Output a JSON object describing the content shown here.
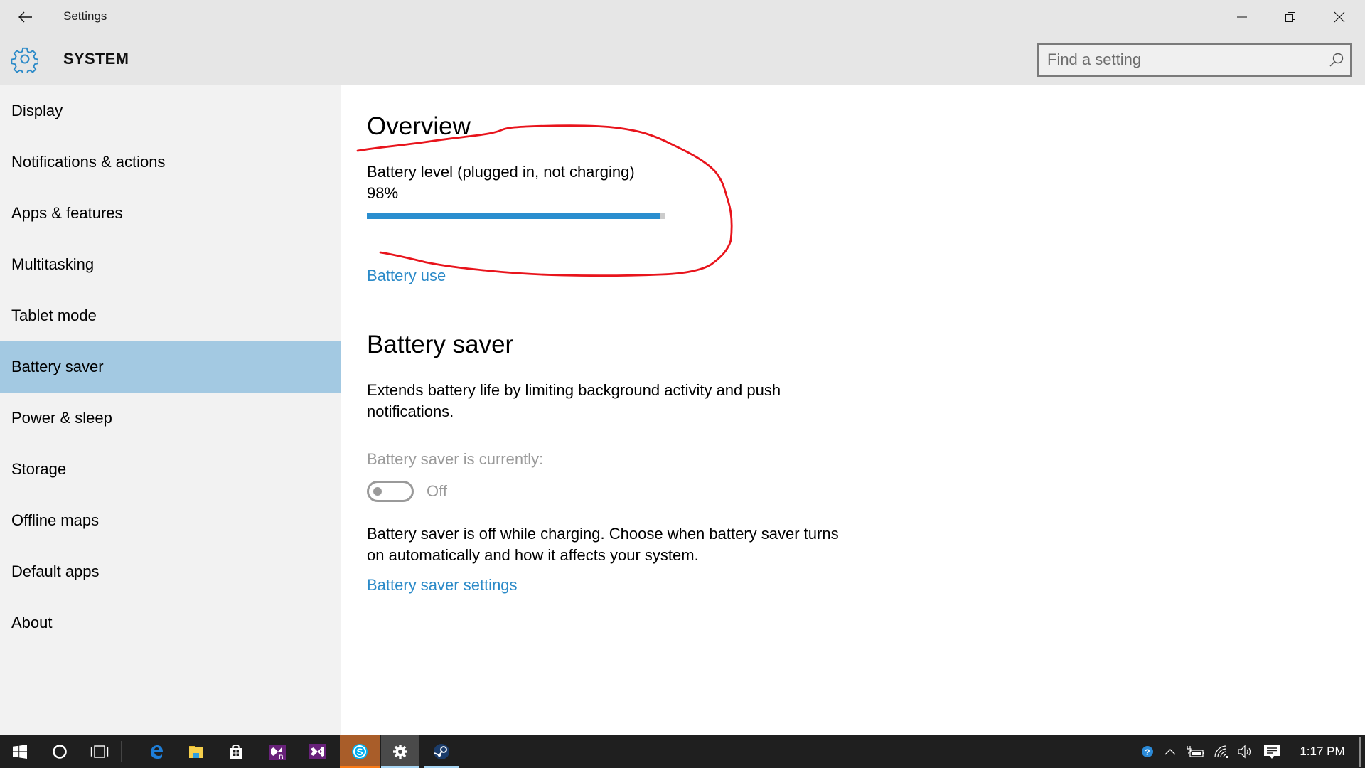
{
  "window": {
    "title": "Settings",
    "section": "SYSTEM",
    "controls": {
      "minimize": "minimize",
      "restore": "restore",
      "close": "close"
    }
  },
  "search": {
    "placeholder": "Find a setting",
    "value": ""
  },
  "sidebar": {
    "selected_index": 5,
    "items": [
      {
        "label": "Display"
      },
      {
        "label": "Notifications & actions"
      },
      {
        "label": "Apps & features"
      },
      {
        "label": "Multitasking"
      },
      {
        "label": "Tablet mode"
      },
      {
        "label": "Battery saver"
      },
      {
        "label": "Power & sleep"
      },
      {
        "label": "Storage"
      },
      {
        "label": "Offline maps"
      },
      {
        "label": "Default apps"
      },
      {
        "label": "About"
      }
    ]
  },
  "overview": {
    "heading": "Overview",
    "battery_label": "Battery level (plugged in, not charging)",
    "battery_percent_text": "98%",
    "battery_percent": 98,
    "battery_use_link": "Battery use"
  },
  "battery_saver": {
    "heading": "Battery saver",
    "description": "Extends battery life by limiting background activity and push notifications.",
    "status_label": "Battery saver is currently:",
    "toggle_state": "Off",
    "toggle_on": false,
    "charging_note": "Battery saver is off while charging. Choose when battery saver turns on automatically and how it affects your system.",
    "settings_link": "Battery saver settings"
  },
  "annotation": {
    "type": "freehand-circle",
    "color": "#e8141c"
  },
  "colors": {
    "accent": "#2a8ecf",
    "link": "#2b8ac8",
    "selected_nav": "#a3c9e2",
    "header_bg": "#e6e6e6",
    "sidebar_bg": "#f2f2f2",
    "taskbar_bg": "#1f1f1f"
  },
  "taskbar": {
    "buttons": [
      {
        "name": "start",
        "icon": "windows-logo-icon"
      },
      {
        "name": "cortana",
        "icon": "cortana-circle-icon"
      },
      {
        "name": "task-view",
        "icon": "task-view-icon"
      },
      {
        "name": "edge",
        "icon": "edge-icon"
      },
      {
        "name": "file-explorer",
        "icon": "folder-icon"
      },
      {
        "name": "store",
        "icon": "store-bag-icon"
      },
      {
        "name": "blend",
        "icon": "visual-studio-blend-icon"
      },
      {
        "name": "visual-studio",
        "icon": "visual-studio-icon"
      },
      {
        "name": "skype",
        "icon": "skype-icon",
        "state": "attention"
      },
      {
        "name": "settings",
        "icon": "gear-icon",
        "state": "active"
      },
      {
        "name": "steam",
        "icon": "steam-icon",
        "state": "open"
      }
    ],
    "tray": [
      {
        "name": "help",
        "icon": "help-circle-icon"
      },
      {
        "name": "show-hidden",
        "icon": "chevron-up-icon"
      },
      {
        "name": "battery",
        "icon": "battery-plugged-icon"
      },
      {
        "name": "wifi",
        "icon": "wifi-icon"
      },
      {
        "name": "volume",
        "icon": "speaker-icon"
      },
      {
        "name": "action-center",
        "icon": "notification-icon"
      }
    ],
    "time": "1:17 PM"
  }
}
